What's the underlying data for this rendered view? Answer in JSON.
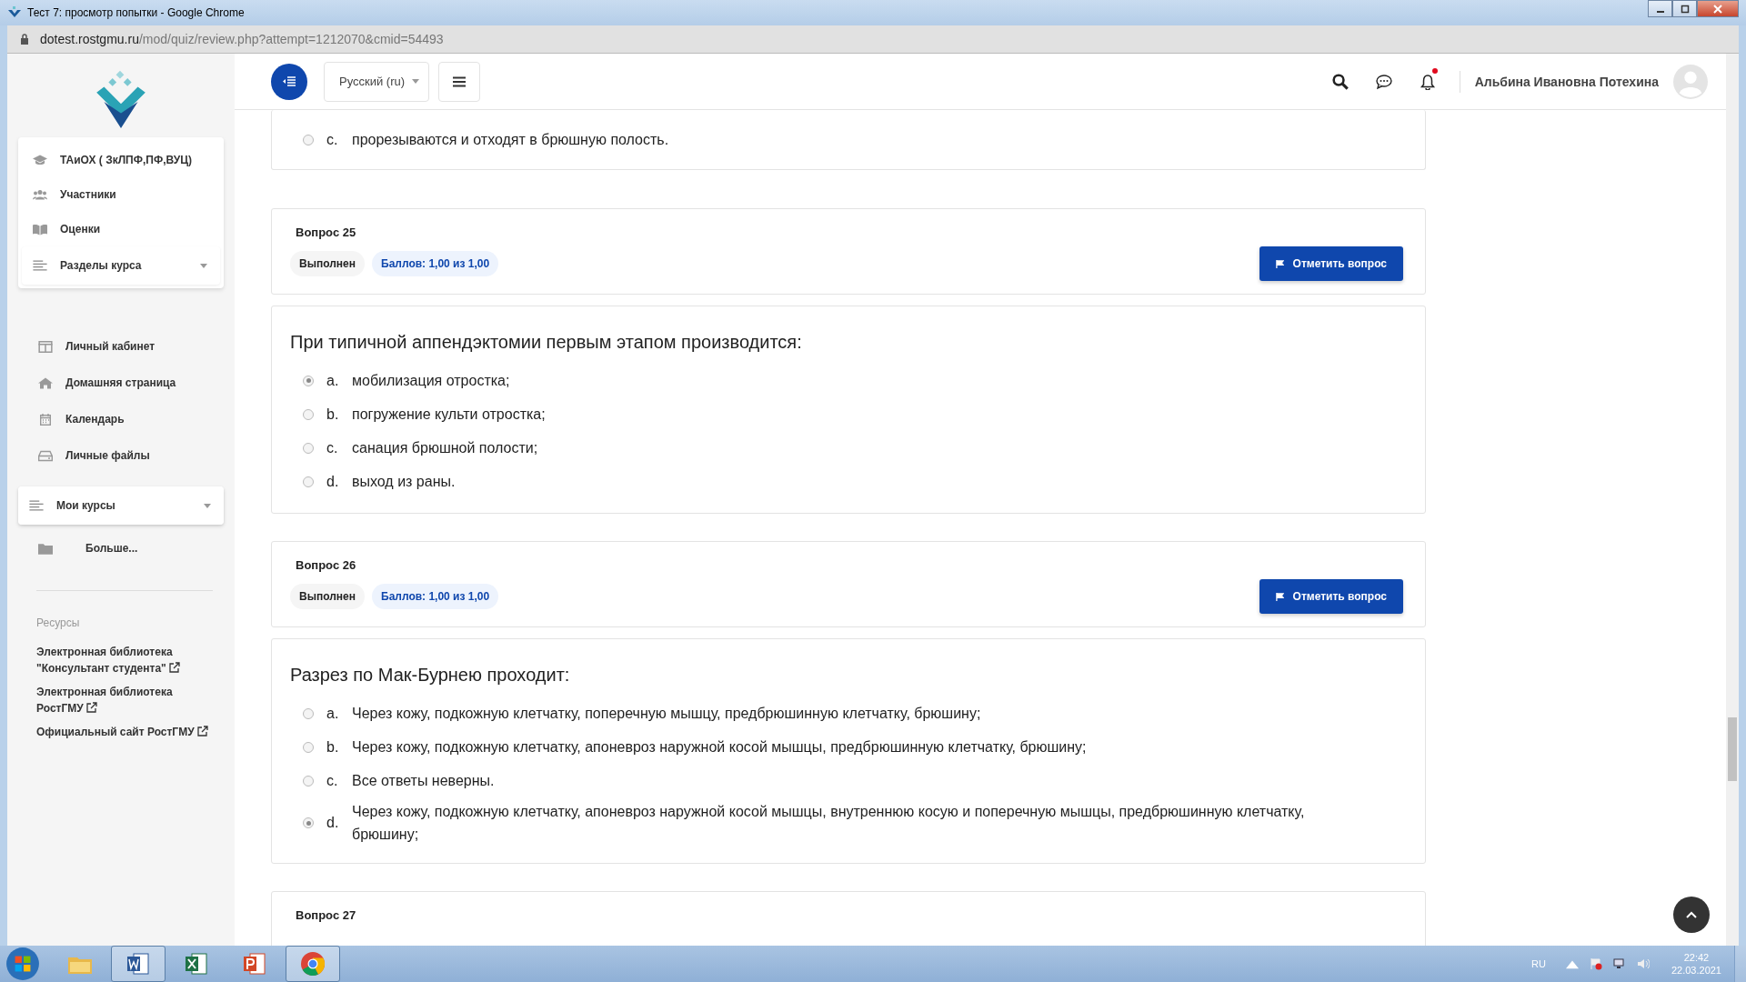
{
  "window": {
    "title": "Тест 7: просмотр попытки - Google Chrome"
  },
  "address_bar": {
    "domain": "dotest.rostgmu.ru",
    "path": "/mod/quiz/review.php?attempt=1212070&cmid=54493"
  },
  "header": {
    "language": "Русский (ru)",
    "has_notification": true,
    "user_name": "Альбина Ивановна Потехина"
  },
  "sidebar": {
    "course_items": [
      {
        "label": "ТАиОХ ( ЗкЛПФ,ПФ,ВУЦ)",
        "kind": "course"
      },
      {
        "label": "Участники",
        "kind": "users"
      },
      {
        "label": "Оценки",
        "kind": "grades"
      }
    ],
    "course_sections": {
      "label": "Разделы курса",
      "expanded": false
    },
    "nav_items": [
      {
        "label": "Личный кабинет",
        "kind": "dashboard"
      },
      {
        "label": "Домашняя страница",
        "kind": "home"
      },
      {
        "label": "Календарь",
        "kind": "calendar"
      },
      {
        "label": "Личные файлы",
        "kind": "files"
      }
    ],
    "my_courses": {
      "label": "Мои курсы",
      "expanded": false
    },
    "more": "Больше...",
    "resources_heading": "Ресурсы",
    "resource_links": [
      "Электронная библиотека \"Консультант студента\"",
      "Электронная библиотека РостГМУ",
      "Официальный сайт РостГМУ"
    ]
  },
  "partial_question": {
    "options": [
      {
        "letter": "c.",
        "text": "прорезываются и отходят в брюшную полость.",
        "selected": false
      }
    ]
  },
  "questions": [
    {
      "number": "Вопрос 25",
      "status": "Выполнен",
      "grade": "Баллов: 1,00 из 1,00",
      "flag_button": "Отметить вопрос",
      "text": "При типичной аппендэктомии первым этапом производится:",
      "options": [
        {
          "letter": "a.",
          "text": "мобилизация отростка;",
          "selected": true
        },
        {
          "letter": "b.",
          "text": "погружение культи отростка;",
          "selected": false
        },
        {
          "letter": "c.",
          "text": "санация брюшной полости;",
          "selected": false
        },
        {
          "letter": "d.",
          "text": "выход из раны.",
          "selected": false
        }
      ]
    },
    {
      "number": "Вопрос 26",
      "status": "Выполнен",
      "grade": "Баллов: 1,00 из 1,00",
      "flag_button": "Отметить вопрос",
      "text": "Разрез по Мак-Бурнею проходит:",
      "options": [
        {
          "letter": "a.",
          "text": "Через кожу, подкожную клетчатку, поперечную мышцу, предбрюшинную клетчатку, брюшину;",
          "selected": false
        },
        {
          "letter": "b.",
          "text": "Через кожу, подкожную клетчатку, апоневроз наружной косой мышцы, предбрюшинную клетчатку, брюшину;",
          "selected": false
        },
        {
          "letter": "c.",
          "text": "Все ответы неверны.",
          "selected": false
        },
        {
          "letter": "d.",
          "text": "Через кожу, подкожную клетчатку, апоневроз наружной косой мышцы, внутреннюю косую и поперечную мышцы, предбрюшинную клетчатку, брюшину;",
          "selected": true
        }
      ]
    }
  ],
  "next_question": {
    "number": "Вопрос 27"
  },
  "taskbar": {
    "apps": [
      {
        "kind": "explorer",
        "running": false
      },
      {
        "kind": "word",
        "running": true
      },
      {
        "kind": "excel",
        "running": false
      },
      {
        "kind": "powerpoint",
        "running": false
      },
      {
        "kind": "chrome",
        "running": true
      }
    ],
    "language": "RU",
    "time": "22:42",
    "date": "22.03.2021"
  }
}
